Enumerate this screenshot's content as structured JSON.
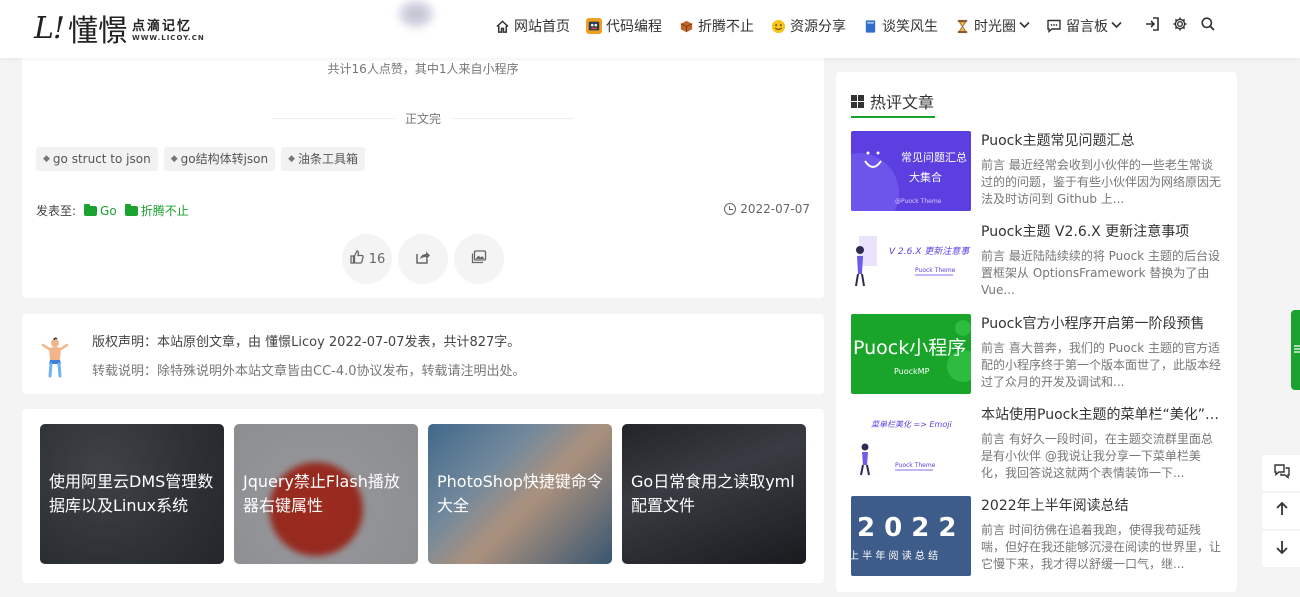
{
  "header": {
    "logo_mark": "L!",
    "logo_name": "懂憬",
    "logo_slogan": "点滴记忆",
    "logo_domain": "WWW.LICOY.CN",
    "nav": [
      {
        "label": "网站首页",
        "icon": "home-icon",
        "caret": false
      },
      {
        "label": "代码编程",
        "icon": "code-icon",
        "caret": false
      },
      {
        "label": "折腾不止",
        "icon": "box-icon",
        "caret": false
      },
      {
        "label": "资源分享",
        "icon": "smile-icon",
        "caret": false
      },
      {
        "label": "谈笑风生",
        "icon": "book-icon",
        "caret": false
      },
      {
        "label": "时光圈",
        "icon": "hourglass-icon",
        "caret": true
      },
      {
        "label": "留言板",
        "icon": "message-icon",
        "caret": true
      }
    ]
  },
  "post": {
    "like_summary": "共计16人点赞，其中1人来自小程序",
    "end_text": "正文完",
    "tags": [
      "go struct to json",
      "go结构体转json",
      "油条工具箱"
    ],
    "publish_label": "发表至:",
    "categories": [
      "Go",
      "折腾不止"
    ],
    "date": "2022-07-07",
    "like_count": "16"
  },
  "copyright": {
    "line1": "版权声明：本站原创文章，由 懂憬Licoy 2022-07-07发表，共计827字。",
    "line2": "转载说明：除特殊说明外本站文章皆由CC-4.0协议发布，转载请注明出处。"
  },
  "related": [
    {
      "title": "使用阿里云DMS管理数据库以及Linux系统",
      "color": "#3b3f45"
    },
    {
      "title": "Jquery禁止Flash播放器右键属性",
      "color": "#c0c2c6"
    },
    {
      "title": "PhotoShop快捷键命令大全",
      "color": "#4a7ca8"
    },
    {
      "title": "Go日常食用之读取yml配置文件",
      "color": "#2a2d33"
    }
  ],
  "sidebar": {
    "title": "热评文章",
    "items": [
      {
        "title": "Puock主题常见问题汇总",
        "excerpt": "前言 最近经常会收到小伙伴的一些老生常谈过的的问题，鉴于有些小伙伴因为网络原因无法及时访问到 Github 上...",
        "thumb_text": "常见问题汇总\n大集合",
        "thumb_sub": "@Puock Theme",
        "thumb_color": "#5b3fe0"
      },
      {
        "title": "Puock主题 V2.6.X 更新注意事项",
        "excerpt": "前言 最近陆陆续续的将 Puock 主题的后台设置框架从 OptionsFramework 替换为了由 Vue...",
        "thumb_text": "V 2.6.X 更新注意事",
        "thumb_sub": "Puock Theme",
        "thumb_color": "#ffffff"
      },
      {
        "title": "Puock官方小程序开启第一阶段预售",
        "excerpt": "前言 喜大普奔，我们的 Puock 主题的官方适配的小程序终于第一个版本面世了，此版本经过了众月的开发及调试和...",
        "thumb_text": "Puock小程序",
        "thumb_sub": "PuockMP",
        "thumb_color": "#18a52a"
      },
      {
        "title": "本站使用Puock主题的菜单栏“美化”方法",
        "excerpt": "前言 有好久一段时间，在主题交流群里面总是有小伙伴 @我说让我分享一下菜单栏美化，我回答说这就两个表情装饰一下...",
        "thumb_text": "菜单栏美化 => Emoji",
        "thumb_sub": "Puock Theme",
        "thumb_color": "#ffffff"
      },
      {
        "title": "2022年上半年阅读总结",
        "excerpt": "前言 时间彷佛在追着我跑，使得我苟延残喘，但好在我还能够沉浸在阅读的世界里，让它慢下来，我才得以舒缓一口气，继...",
        "thumb_text": "2 0 2 2",
        "thumb_sub": "上 半 年 阅 读 总 结",
        "thumb_color": "#3e5c8a"
      }
    ]
  }
}
